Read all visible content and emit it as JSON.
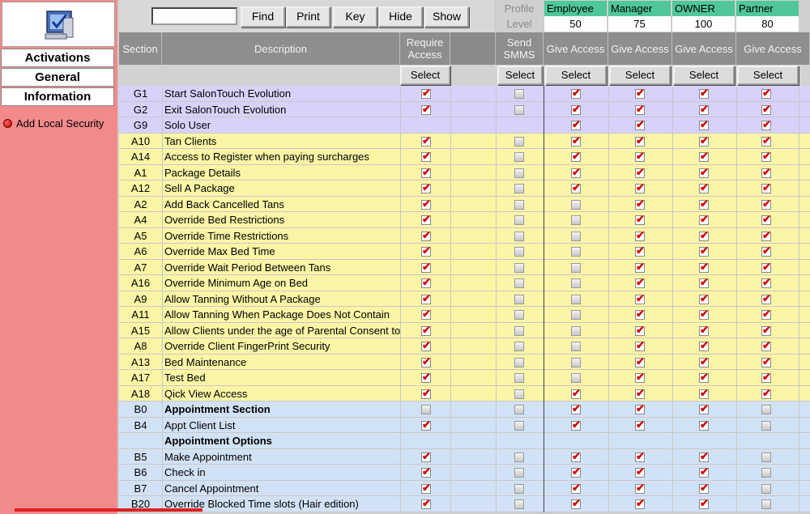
{
  "sidebar": {
    "tabs": [
      "Activations",
      "General",
      "Information"
    ],
    "action": "Add Local Security"
  },
  "toolbar": {
    "search_value": "",
    "buttons": [
      "Find",
      "Print",
      "Key",
      "Hide",
      "Show"
    ]
  },
  "profiles": {
    "profile_label": "Profile",
    "level_label": "Level",
    "columns": [
      {
        "name": "Employee",
        "level": "50"
      },
      {
        "name": "Manager",
        "level": "75"
      },
      {
        "name": "OWNER",
        "level": "100"
      },
      {
        "name": "Partner",
        "level": "80"
      }
    ]
  },
  "columns": {
    "section": "Section",
    "description": "Description",
    "require_access": "Require Access",
    "send_smms": "Send SMMS",
    "give_access": "Give Access",
    "select": "Select"
  },
  "colors": {
    "g_row": "#d8d2fa",
    "a_row": "#fbf5a6",
    "b_row": "#d2e2f6",
    "profile_header": "#4fc79a",
    "sidebar": "#f28a8a"
  },
  "rows": [
    {
      "section": "G1",
      "description": "Start SalonTouch Evolution",
      "bold": false,
      "group": "g",
      "require": true,
      "smms": false,
      "access": [
        true,
        true,
        true,
        true
      ]
    },
    {
      "section": "G2",
      "description": "Exit SalonTouch Evolution",
      "bold": false,
      "group": "g",
      "require": true,
      "smms": false,
      "access": [
        true,
        true,
        true,
        true
      ]
    },
    {
      "section": "G9",
      "description": "Solo User",
      "bold": false,
      "group": "g",
      "require": null,
      "smms": null,
      "access": [
        true,
        true,
        true,
        true
      ]
    },
    {
      "section": "A10",
      "description": "Tan Clients",
      "bold": false,
      "group": "a",
      "require": true,
      "smms": false,
      "access": [
        true,
        true,
        true,
        true
      ]
    },
    {
      "section": "A14",
      "description": "Access to Register when paying surcharges",
      "bold": false,
      "group": "a",
      "require": true,
      "smms": false,
      "access": [
        true,
        true,
        true,
        true
      ]
    },
    {
      "section": "A1",
      "description": "Package Details",
      "bold": false,
      "group": "a",
      "require": true,
      "smms": false,
      "access": [
        true,
        true,
        true,
        true
      ]
    },
    {
      "section": "A12",
      "description": "Sell A Package",
      "bold": false,
      "group": "a",
      "require": true,
      "smms": false,
      "access": [
        true,
        true,
        true,
        true
      ]
    },
    {
      "section": "A2",
      "description": "Add Back Cancelled Tans",
      "bold": false,
      "group": "a",
      "require": true,
      "smms": false,
      "access": [
        false,
        true,
        true,
        true
      ]
    },
    {
      "section": "A4",
      "description": "Override Bed Restrictions",
      "bold": false,
      "group": "a",
      "require": true,
      "smms": false,
      "access": [
        false,
        true,
        true,
        true
      ]
    },
    {
      "section": "A5",
      "description": "Override Time Restrictions",
      "bold": false,
      "group": "a",
      "require": true,
      "smms": false,
      "access": [
        false,
        true,
        true,
        true
      ]
    },
    {
      "section": "A6",
      "description": "Override Max Bed Time",
      "bold": false,
      "group": "a",
      "require": true,
      "smms": false,
      "access": [
        false,
        true,
        true,
        true
      ]
    },
    {
      "section": "A7",
      "description": "Override Wait Period Between Tans",
      "bold": false,
      "group": "a",
      "require": true,
      "smms": false,
      "access": [
        false,
        true,
        true,
        true
      ]
    },
    {
      "section": "A16",
      "description": "Override Minimum Age on Bed",
      "bold": false,
      "group": "a",
      "require": true,
      "smms": false,
      "access": [
        false,
        true,
        true,
        true
      ]
    },
    {
      "section": "A9",
      "description": "Allow Tanning Without A Package",
      "bold": false,
      "group": "a",
      "require": true,
      "smms": false,
      "access": [
        false,
        true,
        true,
        true
      ]
    },
    {
      "section": "A11",
      "description": "Allow Tanning When Package Does Not Contain",
      "bold": false,
      "group": "a",
      "require": true,
      "smms": false,
      "access": [
        false,
        true,
        true,
        true
      ]
    },
    {
      "section": "A15",
      "description": "Allow Clients under the age of Parental Consent to",
      "bold": false,
      "group": "a",
      "require": true,
      "smms": false,
      "access": [
        false,
        true,
        true,
        true
      ]
    },
    {
      "section": "A8",
      "description": "Override Client FingerPrint Security",
      "bold": false,
      "group": "a",
      "require": true,
      "smms": false,
      "access": [
        false,
        true,
        true,
        true
      ]
    },
    {
      "section": "A13",
      "description": "Bed Maintenance",
      "bold": false,
      "group": "a",
      "require": true,
      "smms": false,
      "access": [
        false,
        true,
        true,
        true
      ]
    },
    {
      "section": "A17",
      "description": "Test Bed",
      "bold": false,
      "group": "a",
      "require": true,
      "smms": false,
      "access": [
        false,
        true,
        true,
        true
      ]
    },
    {
      "section": "A18",
      "description": "Qick View Access",
      "bold": false,
      "group": "a",
      "require": true,
      "smms": false,
      "access": [
        true,
        true,
        true,
        true
      ]
    },
    {
      "section": "B0",
      "description": "Appointment Section",
      "bold": true,
      "group": "b",
      "require": false,
      "smms": false,
      "access": [
        true,
        true,
        true,
        false
      ]
    },
    {
      "section": "B4",
      "description": "Appt Client List",
      "bold": false,
      "group": "b",
      "require": true,
      "smms": false,
      "access": [
        true,
        true,
        true,
        false
      ]
    },
    {
      "section": "",
      "description": "Appointment Options",
      "bold": true,
      "group": "b",
      "require": null,
      "smms": null,
      "access": [
        null,
        null,
        null,
        null
      ]
    },
    {
      "section": "B5",
      "description": "Make Appointment",
      "bold": false,
      "group": "b",
      "require": true,
      "smms": false,
      "access": [
        true,
        true,
        true,
        false
      ]
    },
    {
      "section": "B6",
      "description": "Check in",
      "bold": false,
      "group": "b",
      "require": true,
      "smms": false,
      "access": [
        true,
        true,
        true,
        false
      ]
    },
    {
      "section": "B7",
      "description": "Cancel Appointment",
      "bold": false,
      "group": "b",
      "require": true,
      "smms": false,
      "access": [
        true,
        true,
        true,
        false
      ]
    },
    {
      "section": "B20",
      "description": "Override Blocked Time slots (Hair edition)",
      "bold": false,
      "group": "b",
      "require": true,
      "smms": false,
      "access": [
        true,
        true,
        true,
        false
      ]
    }
  ]
}
